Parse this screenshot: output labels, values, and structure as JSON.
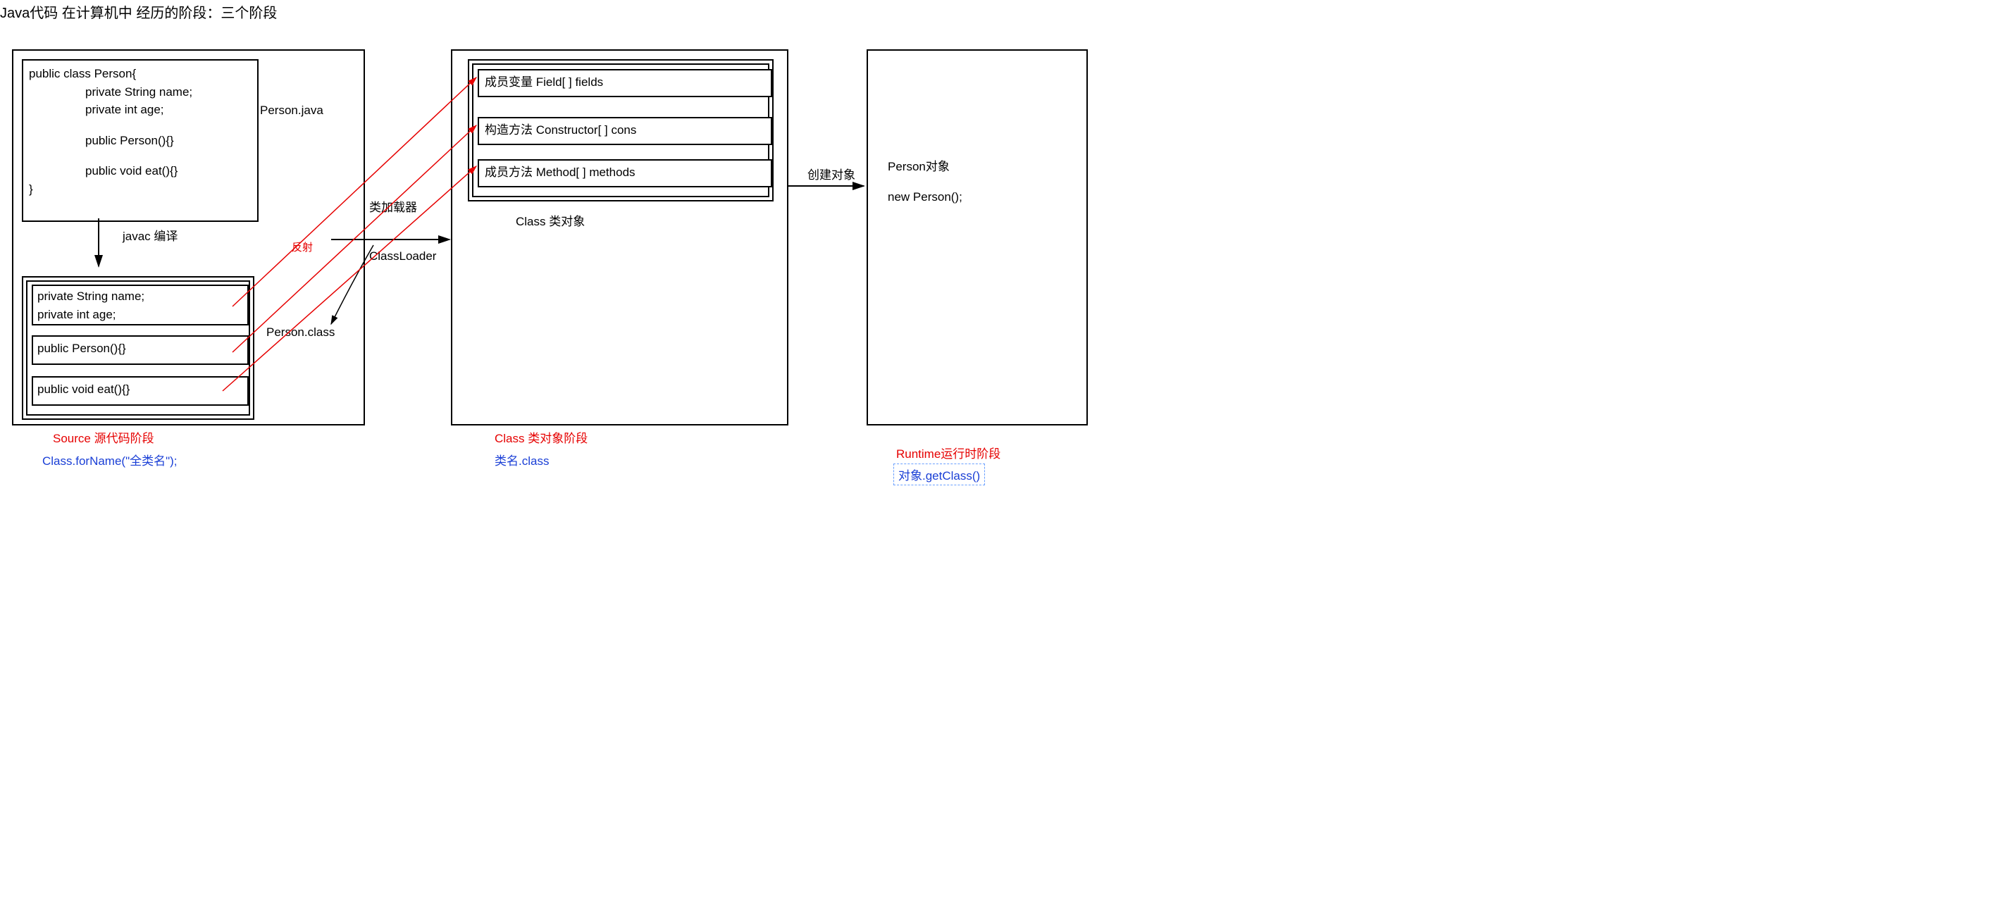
{
  "title": "Java代码 在计算机中 经历的阶段：三个阶段",
  "stage1": {
    "source_title": "Person.java",
    "code": {
      "l1": "public class Person{",
      "l2": "private String name;",
      "l3": "private int age;",
      "l4": "public Person(){}",
      "l5": "public void eat(){}",
      "l6": "}"
    },
    "compile_label": "javac 编译",
    "compiled": {
      "field1": "private String name;",
      "field2": "private int age;",
      "ctor": "public Person(){}",
      "method": "public void eat(){}"
    },
    "compiled_label": "Person.class",
    "caption_red": "Source 源代码阶段",
    "caption_blue": "Class.forName(\"全类名\");"
  },
  "between12": {
    "loader_top": "类加载器",
    "loader_bottom": "ClassLoader",
    "reflect": "反射"
  },
  "stage2": {
    "field": "成员变量  Field[ ] fields",
    "ctor": "构造方法  Constructor[ ] cons",
    "method": "成员方法 Method[ ] methods",
    "obj_label": "Class 类对象",
    "caption_red": "Class 类对象阶段",
    "caption_blue": "类名.class"
  },
  "between23": {
    "create": "创建对象"
  },
  "stage3": {
    "obj": "Person对象",
    "new": "new Person();",
    "caption_red": "Runtime运行时阶段",
    "caption_blue": "对象.getClass()"
  }
}
